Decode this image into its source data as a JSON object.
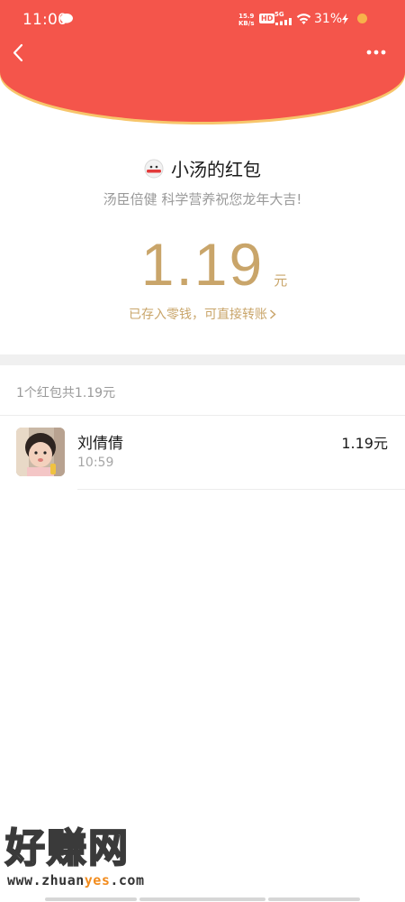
{
  "status_bar": {
    "time": "11:00",
    "net_speed_value": "15.9",
    "net_speed_unit": "KB/s",
    "hd": "HD",
    "signal": "5G",
    "battery": "31%"
  },
  "sender": {
    "name": "小汤的红包",
    "greeting": "汤臣倍健 科学营养祝您龙年大吉!"
  },
  "amount": {
    "value": "1.19",
    "unit": "元",
    "saved_text": "已存入零钱，可直接转账"
  },
  "summary": "1个红包共1.19元",
  "receivers": [
    {
      "name": "刘倩倩",
      "time": "10:59",
      "amount": "1.19元"
    }
  ],
  "watermark": {
    "title": "好赚网",
    "url_prefix": "www.zhuan",
    "url_accent": "yes",
    "url_suffix": ".com"
  },
  "colors": {
    "header_red": "#f4554b",
    "gold": "#c9a56a",
    "header_edge": "#f7c66b"
  }
}
